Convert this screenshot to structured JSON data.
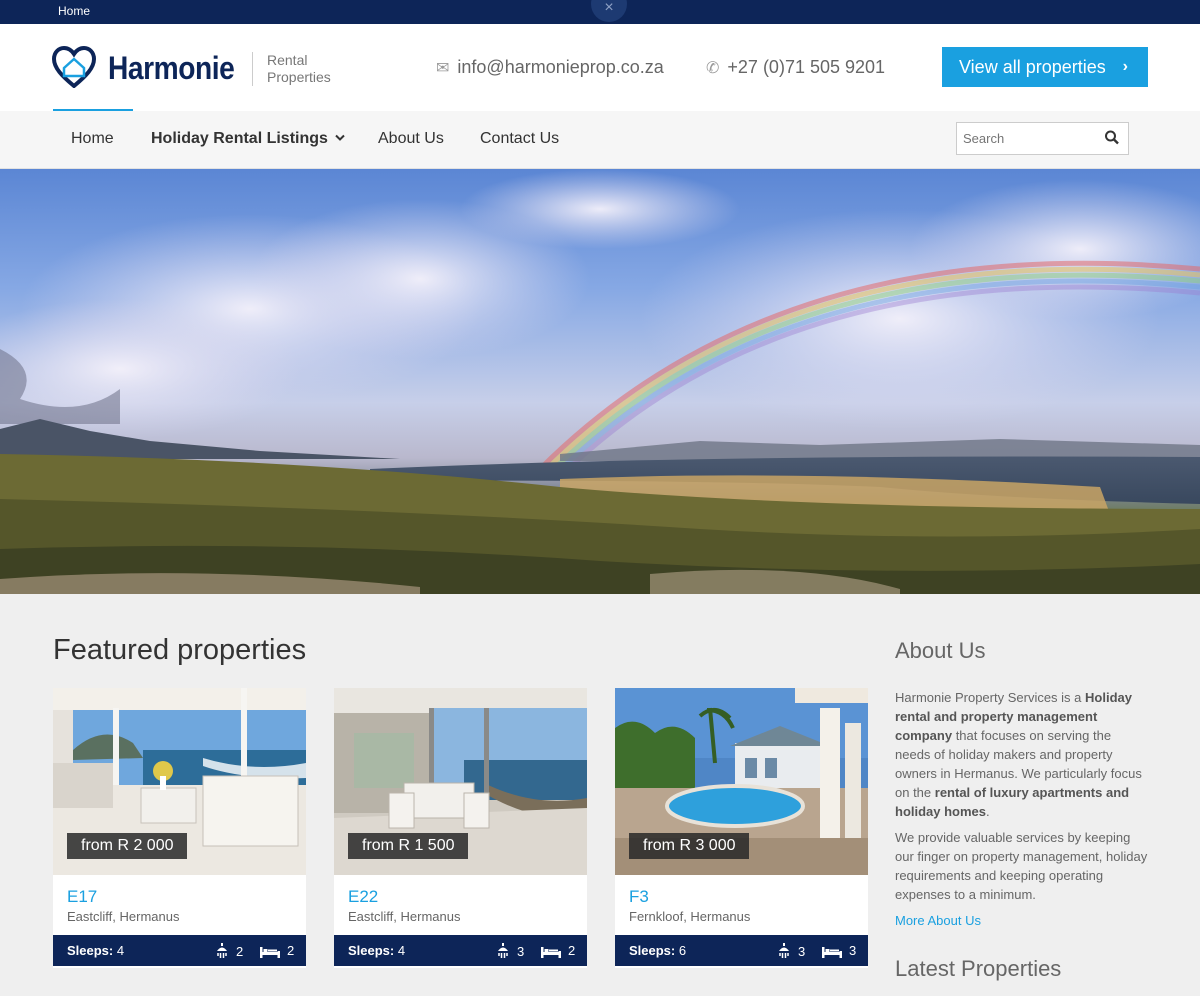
{
  "topbar": {
    "home_label": "Home",
    "close_glyph": "×"
  },
  "header": {
    "brand": "Harmonie",
    "brand_sub_line1": "Rental",
    "brand_sub_line2": "Properties",
    "email": "info@harmonieprop.co.za",
    "phone": "+27 (0)71 505 9201",
    "cta_label": "View all properties"
  },
  "nav": {
    "items": [
      "Home",
      "Holiday Rental Listings",
      "About Us",
      "Contact Us"
    ],
    "search_placeholder": "Search"
  },
  "main": {
    "featured_title": "Featured properties",
    "properties": [
      {
        "price": "from R 2 000",
        "code": "E17",
        "location": "Eastcliff, Hermanus",
        "sleeps_label": "Sleeps:",
        "sleeps": "4",
        "bathrooms": "2",
        "bedrooms": "2"
      },
      {
        "price": "from R 1 500",
        "code": "E22",
        "location": "Eastcliff, Hermanus",
        "sleeps_label": "Sleeps:",
        "sleeps": "4",
        "bathrooms": "3",
        "bedrooms": "2"
      },
      {
        "price": "from R 3 000",
        "code": "F3",
        "location": "Fernkloof, Hermanus",
        "sleeps_label": "Sleeps:",
        "sleeps": "6",
        "bathrooms": "3",
        "bedrooms": "3"
      }
    ]
  },
  "sidebar": {
    "about_title": "About Us",
    "about_p1_a": "Harmonie Property Services is a ",
    "about_p1_b": "Holiday rental and property management company",
    "about_p1_c": " that focuses on serving the needs of holiday makers and property owners in Hermanus. We particularly focus on the ",
    "about_p1_d": "rental of luxury apartments and holiday homes",
    "about_p1_e": ".",
    "about_p2": "We provide valuable services by keeping our finger on property management, holiday requirements and keeping operating expenses to a minimum.",
    "more_link": "More About Us",
    "latest_title": "Latest Properties"
  },
  "colors": {
    "navy": "#0d2558",
    "accent": "#1aa0e0"
  },
  "icons": [
    "close-icon",
    "house-heart-logo-icon",
    "envelope-icon",
    "phone-icon",
    "chevron-right-icon",
    "chevron-down-icon",
    "search-icon",
    "shower-icon",
    "bed-icon"
  ]
}
